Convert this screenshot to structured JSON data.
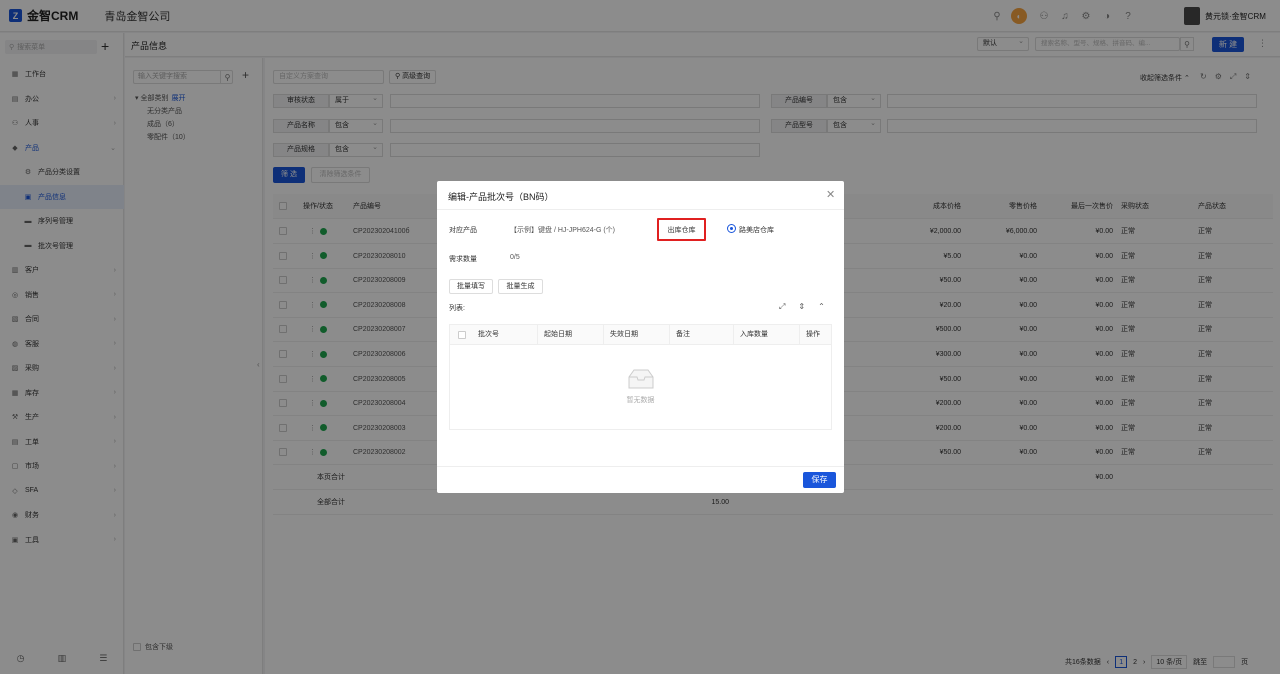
{
  "app": {
    "brand": "金智CRM",
    "company": "青岛金智公司",
    "user": "黄元锁·金智CRM"
  },
  "sidebar": {
    "search_placeholder": "搜索菜单",
    "items": [
      "工作台",
      "办公",
      "人事",
      "产品",
      "产品分类设置",
      "产品信息",
      "序列号管理",
      "批次号管理",
      "客户",
      "销售",
      "合同",
      "客服",
      "采购",
      "库存",
      "生产",
      "工单",
      "市场",
      "SFA",
      "财务",
      "工具"
    ]
  },
  "page": {
    "title": "产品信息",
    "view_select": "默认",
    "search_placeholder": "搜索名称、型号、规格、拼音码、编...",
    "new_label": "新 建"
  },
  "tree": {
    "search_placeholder": "输入关键字搜索",
    "root": "全部类别",
    "expand": "展开",
    "children": [
      "无分类产品",
      "成品（6）",
      "零配件（10）"
    ],
    "include_sub": "包含下级"
  },
  "filters": {
    "custom_placeholder": "自定义方案查询",
    "advanced": "高级查询",
    "collapse": "收起筛选条件",
    "rows": [
      {
        "label": "审核状态",
        "op": "属于"
      },
      {
        "label": "产品编号",
        "op": "包含"
      },
      {
        "label": "产品名称",
        "op": "包含"
      },
      {
        "label": "产品型号",
        "op": "包含"
      },
      {
        "label": "产品规格",
        "op": "包含"
      }
    ],
    "filter_btn": "筛 选",
    "clear_btn": "清除筛选条件"
  },
  "table": {
    "headers": [
      "操作/状态",
      "产品编号",
      "成本价格",
      "零售价格",
      "最后一次售价",
      "采购状态",
      "产品状态"
    ],
    "rows": [
      {
        "code": "CP20230204100б",
        "cost": "¥2,000.00",
        "retail": "¥6,000.00",
        "last": "¥0.00",
        "buy": "正常",
        "status": "正常"
      },
      {
        "code": "CP20230208010",
        "cost": "¥5.00",
        "retail": "¥0.00",
        "last": "¥0.00",
        "buy": "正常",
        "status": "正常"
      },
      {
        "code": "CP20230208009",
        "cost": "¥50.00",
        "retail": "¥0.00",
        "last": "¥0.00",
        "buy": "正常",
        "status": "正常"
      },
      {
        "code": "CP20230208008",
        "cost": "¥20.00",
        "retail": "¥0.00",
        "last": "¥0.00",
        "buy": "正常",
        "status": "正常"
      },
      {
        "code": "CP20230208007",
        "cost": "¥500.00",
        "retail": "¥0.00",
        "last": "¥0.00",
        "buy": "正常",
        "status": "正常"
      },
      {
        "code": "CP20230208006",
        "cost": "¥300.00",
        "retail": "¥0.00",
        "last": "¥0.00",
        "buy": "正常",
        "status": "正常"
      },
      {
        "code": "CP20230208005",
        "cost": "¥50.00",
        "retail": "¥0.00",
        "last": "¥0.00",
        "buy": "正常",
        "status": "正常"
      },
      {
        "code": "CP20230208004",
        "cost": "¥200.00",
        "retail": "¥0.00",
        "last": "¥0.00",
        "buy": "正常",
        "status": "正常"
      },
      {
        "code": "CP20230208003",
        "cost": "¥200.00",
        "retail": "¥0.00",
        "last": "¥0.00",
        "buy": "正常",
        "status": "正常"
      },
      {
        "code": "CP20230208002",
        "cost": "¥50.00",
        "retail": "¥0.00",
        "last": "¥0.00",
        "buy": "正常",
        "status": "正常"
      }
    ],
    "page_total_label": "本页合计",
    "page_total_last": "¥0.00",
    "all_total_label": "全部合计",
    "all_total_value": "15.00"
  },
  "pager": {
    "total": "共16条数据",
    "page1": "1",
    "page2": "2",
    "size": "10 条/页",
    "jump": "跳至",
    "page_unit": "页"
  },
  "modal": {
    "title": "编辑-产品批次号（BN码）",
    "product_label": "对应产品",
    "product_value": "【示例】键盘 / HJ-JPH624-G (个)",
    "warehouse_label": "出库仓库",
    "warehouse_option": "路美店仓库",
    "qty_label": "需求数量",
    "qty_value": "0/5",
    "batch_fill": "批量填写",
    "batch_gen": "批量生成",
    "list_label": "列表:",
    "columns": [
      "批次号",
      "起始日期",
      "失效日期",
      "备注",
      "入库数量",
      "操作"
    ],
    "empty": "暂无数据",
    "save": "保存"
  }
}
